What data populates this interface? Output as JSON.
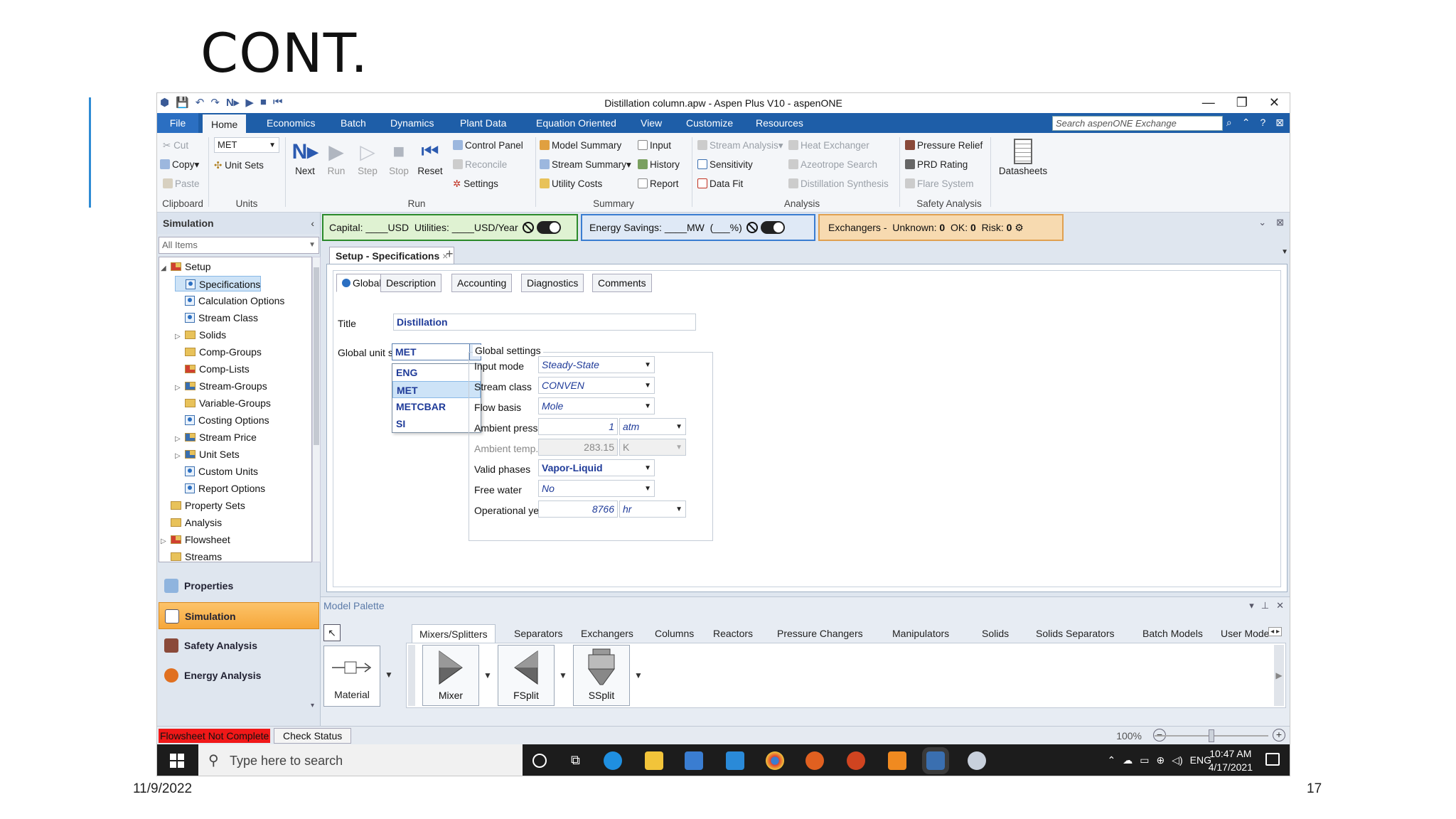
{
  "slide": {
    "title": "CONT.",
    "date": "11/9/2022",
    "page_number": "17"
  },
  "window": {
    "title": "Distillation column.apw - Aspen Plus V10 - aspenONE"
  },
  "menu": {
    "tabs": [
      "File",
      "Home",
      "Economics",
      "Batch",
      "Dynamics",
      "Plant Data",
      "Equation Oriented",
      "View",
      "Customize",
      "Resources"
    ],
    "search_placeholder": "Search aspenONE Exchange"
  },
  "ribbon": {
    "clipboard": {
      "cut": "Cut",
      "copy": "Copy",
      "paste": "Paste",
      "group": "Clipboard"
    },
    "units": {
      "unit_set_value": "MET",
      "unit_sets": "Unit Sets",
      "group": "Units"
    },
    "run": {
      "next": "Next",
      "run": "Run",
      "step": "Step",
      "stop": "Stop",
      "reset": "Reset",
      "control_panel": "Control Panel",
      "reconcile": "Reconcile",
      "settings": "Settings",
      "group": "Run"
    },
    "summary": {
      "model_summary": "Model Summary",
      "stream_summary": "Stream Summary",
      "utility_costs": "Utility Costs",
      "input": "Input",
      "history": "History",
      "report": "Report",
      "group": "Summary"
    },
    "analysis": {
      "stream_analysis": "Stream Analysis",
      "sensitivity": "Sensitivity",
      "data_fit": "Data Fit",
      "heat_exchanger": "Heat Exchanger",
      "azeotrope_search": "Azeotrope Search",
      "distillation_synthesis": "Distillation Synthesis",
      "group": "Analysis"
    },
    "safety": {
      "pressure_relief": "Pressure Relief",
      "prd_rating": "PRD Rating",
      "flare_system": "Flare System",
      "group": "Safety Analysis"
    },
    "datasheets": "Datasheets"
  },
  "nav": {
    "header": "Simulation",
    "filter": "All Items",
    "tree": [
      {
        "label": "Setup",
        "depth": 0,
        "icon": "folder-red",
        "expanded": true
      },
      {
        "label": "Specifications",
        "depth": 1,
        "icon": "check-form",
        "selected": true
      },
      {
        "label": "Calculation Options",
        "depth": 1,
        "icon": "check-form"
      },
      {
        "label": "Stream Class",
        "depth": 1,
        "icon": "check-form"
      },
      {
        "label": "Solids",
        "depth": 1,
        "icon": "folder",
        "collapsed": true
      },
      {
        "label": "Comp-Groups",
        "depth": 1,
        "icon": "folder"
      },
      {
        "label": "Comp-Lists",
        "depth": 1,
        "icon": "folder-red"
      },
      {
        "label": "Stream-Groups",
        "depth": 1,
        "icon": "folder-blue",
        "collapsed": true
      },
      {
        "label": "Variable-Groups",
        "depth": 1,
        "icon": "folder"
      },
      {
        "label": "Costing Options",
        "depth": 1,
        "icon": "check-form"
      },
      {
        "label": "Stream Price",
        "depth": 1,
        "icon": "folder-blue",
        "collapsed": true
      },
      {
        "label": "Unit Sets",
        "depth": 1,
        "icon": "folder-blue",
        "collapsed": true
      },
      {
        "label": "Custom Units",
        "depth": 1,
        "icon": "check-form"
      },
      {
        "label": "Report Options",
        "depth": 1,
        "icon": "check-form"
      },
      {
        "label": "Property Sets",
        "depth": 0,
        "icon": "folder"
      },
      {
        "label": "Analysis",
        "depth": 0,
        "icon": "folder"
      },
      {
        "label": "Flowsheet",
        "depth": 0,
        "icon": "folder-red",
        "collapsed": true
      },
      {
        "label": "Streams",
        "depth": 0,
        "icon": "folder"
      }
    ],
    "sections": [
      "Properties",
      "Simulation",
      "Safety Analysis",
      "Energy Analysis"
    ],
    "active_section": "Simulation"
  },
  "banner": {
    "capital": "Capital: ____USD",
    "utilities": "Utilities: ____USD/Year",
    "energy": "Energy Savings: ____MW",
    "energy_pct": "(___%)",
    "exchangers": "Exchangers -",
    "unknown": "Unknown:",
    "unknown_val": "0",
    "ok": "OK:",
    "ok_val": "0",
    "risk": "Risk:",
    "risk_val": "0"
  },
  "doc": {
    "tab": "Setup - Specifications",
    "form_tabs": [
      "Global",
      "Description",
      "Accounting",
      "Diagnostics",
      "Comments"
    ],
    "title_label": "Title",
    "title_value": "Distillation",
    "unit_label": "Global unit set",
    "unit_value": "MET",
    "unit_options": [
      "ENG",
      "MET",
      "METCBAR",
      "SI"
    ],
    "unit_selected": "MET",
    "global_settings": "Global settings",
    "fields": [
      {
        "label": "Input mode",
        "value": "Steady-State",
        "unit": ""
      },
      {
        "label": "Stream class",
        "value": "CONVEN",
        "unit": ""
      },
      {
        "label": "Flow basis",
        "value": "Mole",
        "unit": ""
      },
      {
        "label": "Ambient pressure",
        "value": "1",
        "unit": "atm"
      },
      {
        "label": "Ambient temp.",
        "value": "283.15",
        "unit": "K"
      },
      {
        "label": "Valid phases",
        "value": "Vapor-Liquid",
        "unit": ""
      },
      {
        "label": "Free water",
        "value": "No",
        "unit": ""
      },
      {
        "label": "Operational year",
        "value": "8766",
        "unit": "hr"
      }
    ]
  },
  "palette": {
    "title": "Model Palette",
    "tabs": [
      "Mixers/Splitters",
      "Separators",
      "Exchangers",
      "Columns",
      "Reactors",
      "Pressure Changers",
      "Manipulators",
      "Solids",
      "Solids Separators",
      "Batch Models",
      "User Mode"
    ],
    "material": "Material",
    "items": [
      "Mixer",
      "FSplit",
      "SSplit"
    ]
  },
  "status": {
    "error": "Flowsheet Not Complete",
    "check": "Check Status",
    "zoom": "100%",
    "zoom_level": 0.5
  },
  "taskbar": {
    "search": "Type here to search",
    "lang": "ENG",
    "time": "10:47 AM",
    "date": "4/17/2021"
  }
}
